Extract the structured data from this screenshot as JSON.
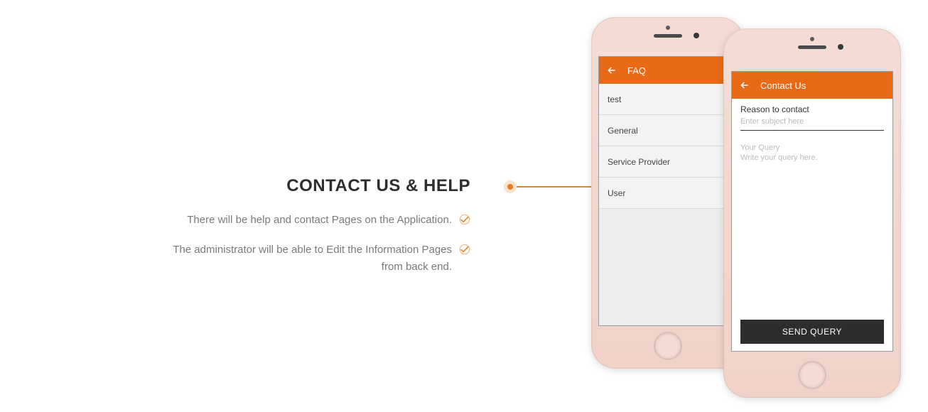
{
  "colors": {
    "accent": "#e86a17",
    "connector": "#e38a2e",
    "button_dark": "#2d2d2d"
  },
  "section": {
    "title": "CONTACT US & HELP",
    "bullets": [
      "There will be help and contact Pages on the Application.",
      "The administrator will be able to Edit the Information Pages from back end."
    ]
  },
  "faq_screen": {
    "header_title": "FAQ",
    "items": [
      "test",
      "General",
      "Service Provider",
      "User"
    ]
  },
  "contact_screen": {
    "header_title": "Contact Us",
    "reason_label": "Reason to contact",
    "subject_placeholder": "Enter subject here",
    "query_label": "Your Query",
    "query_placeholder": "Write your query here.",
    "send_button": "SEND QUERY"
  }
}
